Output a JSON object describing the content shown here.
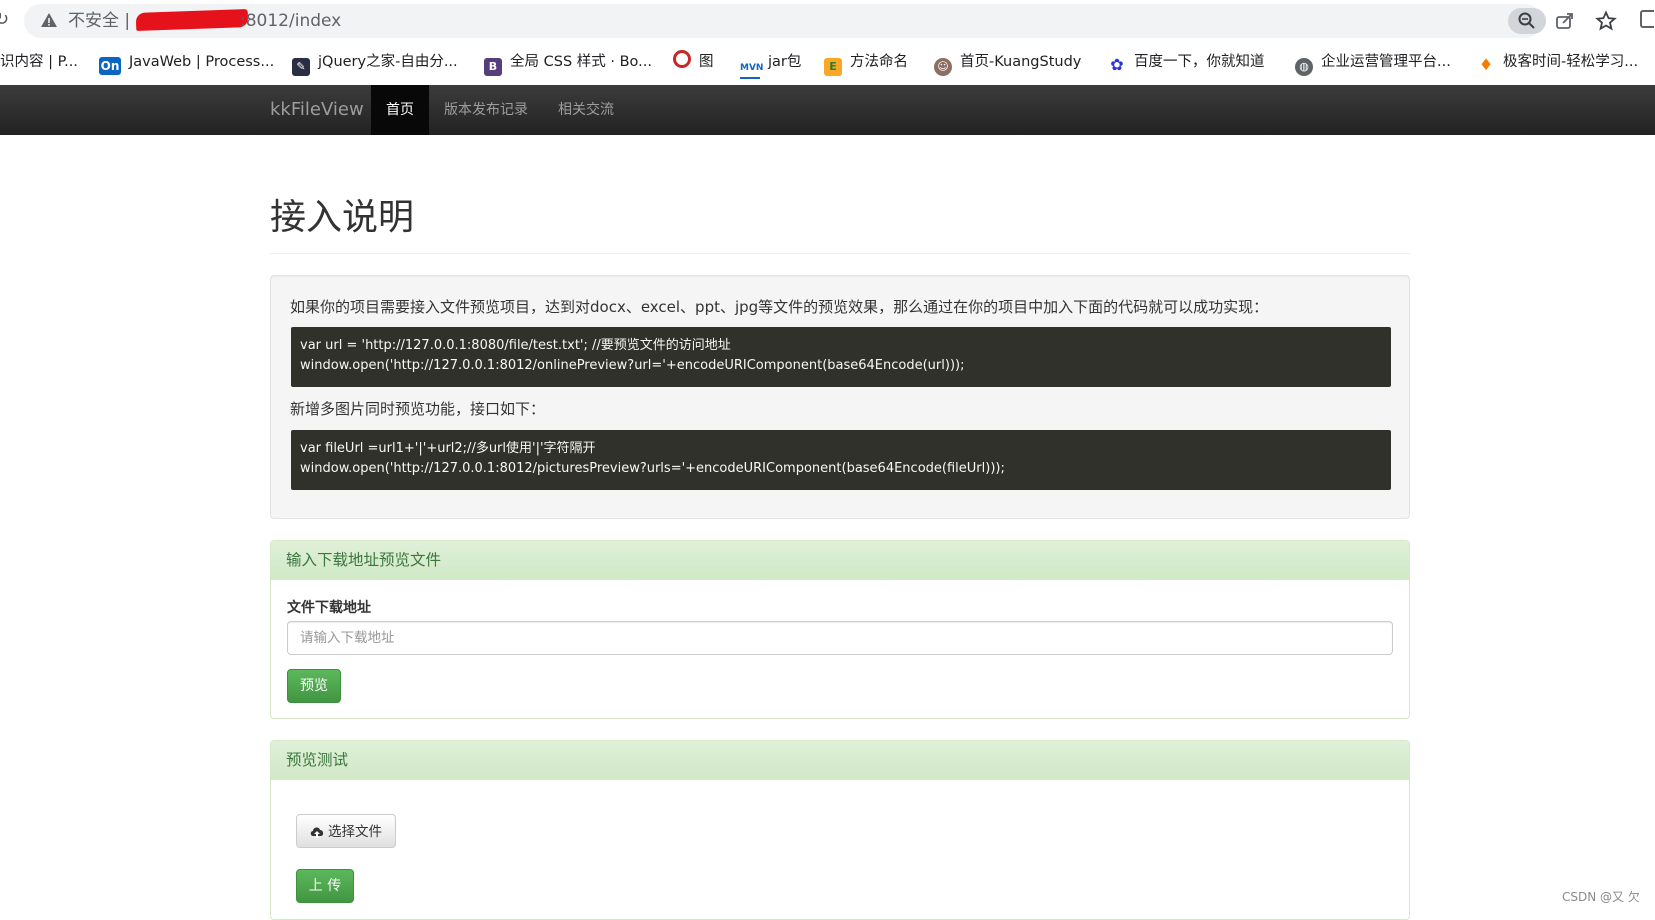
{
  "browser": {
    "security_label": "不安全 |",
    "url": ":8012/index"
  },
  "bookmarks": [
    {
      "label": "识内容 | P...",
      "icon": "none",
      "color": ""
    },
    {
      "label": "JavaWeb | Process...",
      "icon": "On",
      "color": "#0a66c2"
    },
    {
      "label": "jQuery之家-自由分...",
      "icon": "leaf",
      "color": "#2b2d42"
    },
    {
      "label": "全局 CSS 样式 · Bo...",
      "icon": "B",
      "color": "#563d7c"
    },
    {
      "label": "图",
      "icon": "ring",
      "color": "#c62828"
    },
    {
      "label": "jar包",
      "icon": "MVN",
      "color": "#1565c0"
    },
    {
      "label": "方法命名",
      "icon": "E",
      "color": "#f9a825"
    },
    {
      "label": "首页-KuangStudy",
      "icon": "avatar",
      "color": "#8d6e63"
    },
    {
      "label": "百度一下，你就知道",
      "icon": "paw",
      "color": "#2932e1"
    },
    {
      "label": "企业运营管理平台...",
      "icon": "globe",
      "color": "#5f6368"
    },
    {
      "label": "极客时间-轻松学习...",
      "icon": "pin",
      "color": "#f57c00"
    }
  ],
  "navbar": {
    "brand": "kkFileView",
    "items": [
      {
        "label": "首页",
        "active": true
      },
      {
        "label": "版本发布记录",
        "active": false
      },
      {
        "label": "相关交流",
        "active": false
      }
    ]
  },
  "intro": {
    "title": "接入说明",
    "description": "如果你的项目需要接入文件预览项目，达到对docx、excel、ppt、jpg等文件的预览效果，那么通过在你的项目中加入下面的代码就可以成功实现：",
    "code1_line1": "var url = 'http://127.0.0.1:8080/file/test.txt'; //要预览文件的访问地址",
    "code1_line2": "window.open('http://127.0.0.1:8012/onlinePreview?url='+encodeURIComponent(base64Encode(url)));",
    "multi_title": "新增多图片同时预览功能，接口如下：",
    "code2_line1": "var fileUrl =url1+'|'+url2;//多url使用'|'字符隔开",
    "code2_line2": "window.open('http://127.0.0.1:8012/picturesPreview?urls='+encodeURIComponent(base64Encode(fileUrl)));"
  },
  "download_panel": {
    "heading": "输入下载地址预览文件",
    "field_label": "文件下载地址",
    "input_value": "",
    "input_placeholder": "请输入下载地址",
    "preview_button": "预览"
  },
  "test_panel": {
    "heading": "预览测试",
    "choose_file_button": "选择文件",
    "upload_button": "上 传"
  },
  "watermark": "CSDN @又 欠",
  "colors": {
    "navbar_bg": "#222222",
    "active_nav": "#080808",
    "panel_head": "#dff0d8",
    "panel_text": "#3c763d",
    "success_btn": "#5cb85c",
    "code_bg": "#31312c"
  }
}
